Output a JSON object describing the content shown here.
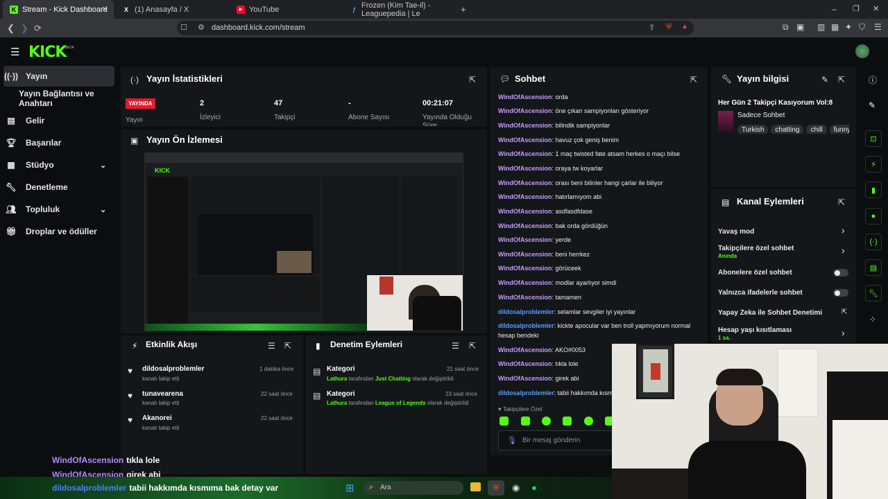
{
  "browser": {
    "tabs": [
      {
        "label": "Stream - Kick Dashboard",
        "active": true
      },
      {
        "label": "(1) Anasayfa / X"
      },
      {
        "label": "YouTube"
      },
      {
        "label": "Frozen (Kim Tae-il) - Leaguepedia | Le"
      }
    ],
    "url": "dashboard.kick.com/stream"
  },
  "brand": {
    "logo": "KICK",
    "beta": "BETA",
    "accent": "#53fc18"
  },
  "sidebar": {
    "items": [
      {
        "label": "Yayın",
        "icon": "broadcast-icon"
      },
      {
        "label": "Yayın Bağlantısı ve Anahtarı",
        "icon": ""
      },
      {
        "label": "Gelir",
        "icon": "chart-icon"
      },
      {
        "label": "Başarılar",
        "icon": "trophy-icon"
      },
      {
        "label": "Stüdyo",
        "icon": "studio-icon"
      },
      {
        "label": "Denetleme",
        "icon": "wrench-icon"
      },
      {
        "label": "Topluluk",
        "icon": "community-icon"
      },
      {
        "label": "Droplar ve ödüller",
        "icon": "gift-icon"
      }
    ]
  },
  "stats": {
    "title": "Yayın İstatistikleri",
    "live_badge": "YAYINDA",
    "live_label": "Yayın",
    "viewers_value": "2",
    "viewers_label": "İzleyici",
    "followers_value": "47",
    "followers_label": "Takipçi",
    "subs_value": "-",
    "subs_label": "Abone Sayısı",
    "uptime_value": "00:21:07",
    "uptime_label": "Yayında Olduğu Süre"
  },
  "preview": {
    "title": "Yayın Ön İzlemesi"
  },
  "activity": {
    "title": "Etkinlik Akışı",
    "items": [
      {
        "name": "dildosalproblemler",
        "sub": "kanalı takip etti",
        "time": "1 dakika önce"
      },
      {
        "name": "tunavearena",
        "sub": "kanalı takip etti",
        "time": "22 saat önce"
      },
      {
        "name": "Akanorei",
        "sub": "kanalı takip etti",
        "time": "22 saat önce"
      }
    ]
  },
  "moderation": {
    "title": "Denetim Eylemleri",
    "items": [
      {
        "label": "Kategori",
        "actor": "Lathura",
        "mid": " tarafından ",
        "target": "Just Chatting",
        "tail": " olarak değiştirildi",
        "time": "21 saat önce"
      },
      {
        "label": "Kategori",
        "actor": "Lathura",
        "mid": " tarafından ",
        "target": "League of Legends",
        "tail": " olarak değiştirildi",
        "time": "23 saat önce"
      }
    ]
  },
  "chat": {
    "title": "Sohbet",
    "messages": [
      {
        "user": "WindOfAscension",
        "text": "orda"
      },
      {
        "user": "WindOfAscension",
        "text": "öne çıkan sampiyonları gösteriyor"
      },
      {
        "user": "WindOfAscension",
        "text": "bilindik sampiyonlar"
      },
      {
        "user": "WindOfAscension",
        "text": "havuz çok geniş benim"
      },
      {
        "user": "WindOfAscension",
        "text": "1 maç twisted fate atsam herkes o maçı bilse"
      },
      {
        "user": "WindOfAscension",
        "text": "oraya tw koyarlar"
      },
      {
        "user": "WindOfAscension",
        "text": "orası beni bilinler hangi çarlar ile biliyor"
      },
      {
        "user": "WindOfAscension",
        "text": "hatırlamıyom abi"
      },
      {
        "user": "WindOfAscension",
        "text": "asdfasdfdase"
      },
      {
        "user": "WindOfAscension",
        "text": "bak orda gördüğün"
      },
      {
        "user": "WindOfAscension",
        "text": "yerde"
      },
      {
        "user": "WindOfAscension",
        "text": "beni herrkez"
      },
      {
        "user": "WindOfAscension",
        "text": "görüceek"
      },
      {
        "user": "WindOfAscension",
        "text": "modlar ayarlıyor simdi"
      },
      {
        "user": "WindOfAscension",
        "text": "tamamen"
      },
      {
        "user": "dildosalproblemler",
        "text": "selamlar sevgiler iyi yayınlar"
      },
      {
        "user": "dildosalproblemler",
        "text": "kickte apocular var ben troll yapmıyorum normal"
      },
      {
        "user": "",
        "text": "hesap bendeki"
      },
      {
        "user": "WindOfAscension",
        "text": "AKO#0053"
      },
      {
        "user": "WindOfAscension",
        "text": "tıkla lole"
      },
      {
        "user": "WindOfAscension",
        "text": "girek abi"
      },
      {
        "user": "dildosalproblemler",
        "text": "tabii hakkımda kısm"
      }
    ],
    "followers_only": "Takipçilere Özel",
    "input_placeholder": "Bir mesaj gönderin"
  },
  "stream_info": {
    "title": "Yayın bilgisi",
    "stream_title": "Her Gün 2 Takipçi Kasıyorum Vol:8",
    "category": "Sadece Sohbet",
    "tags": [
      "Turkish",
      "chatting",
      "chill",
      "funny"
    ]
  },
  "channel_actions": {
    "title": "Kanal Eylemleri",
    "items": [
      {
        "label": "Yavaş mod",
        "sub": "",
        "control": "chevron"
      },
      {
        "label": "Takipçilere özel sohbet",
        "sub": "Anında",
        "control": "chevron"
      },
      {
        "label": "Abonelere özel sohbet",
        "sub": "",
        "control": "toggle"
      },
      {
        "label": "Yalnızca ifadelerle sohbet",
        "sub": "",
        "control": "toggle"
      },
      {
        "label": "Yapay Zeka ile Sohbet Denetimi",
        "sub": "",
        "control": "external"
      },
      {
        "label": "Hesap yaşı kısıtlaması",
        "sub": "1 sa.",
        "control": "chevron"
      }
    ]
  },
  "overlay_chat": [
    {
      "user": "WindOfAscension",
      "text": "tıkla lole"
    },
    {
      "user": "WindOfAscension",
      "text": "girek abi"
    },
    {
      "user": "dildosalproblemler",
      "text": "tabii hakkımda kısmıma bak detay var"
    }
  ],
  "taskbar": {
    "search_placeholder": "Ara"
  }
}
